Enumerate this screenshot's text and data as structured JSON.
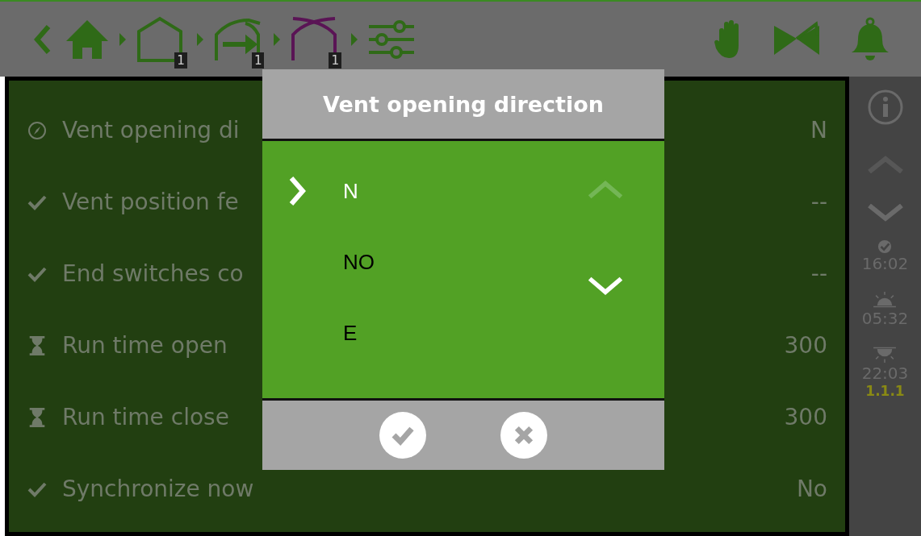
{
  "breadcrumb": [
    {
      "kind": "home"
    },
    {
      "kind": "house",
      "badge": "1",
      "color": "#2f6a17"
    },
    {
      "kind": "vent",
      "badge": "1",
      "color": "#2f6a17"
    },
    {
      "kind": "roof",
      "badge": "1",
      "color": "#5a1455"
    },
    {
      "kind": "settings"
    }
  ],
  "rows": [
    {
      "kind": "compass",
      "label": "Vent opening di",
      "value": "N"
    },
    {
      "kind": "check",
      "label": "Vent position fe",
      "value": "--"
    },
    {
      "kind": "check",
      "label": "End switches co",
      "value": "--"
    },
    {
      "kind": "timer",
      "label": "Run time open",
      "value": "300"
    },
    {
      "kind": "timer",
      "label": "Run time close",
      "value": "300"
    },
    {
      "kind": "check",
      "label": "Synchronize now",
      "value": "No"
    }
  ],
  "sidebar": {
    "up_disabled": true,
    "down_disabled": false,
    "times": [
      {
        "kind": "clock",
        "time": "16:02"
      },
      {
        "kind": "sunrise",
        "time": "05:32"
      },
      {
        "kind": "sunset",
        "time": "22:03"
      }
    ],
    "version": "1.1.1"
  },
  "dialog": {
    "title": "Vent opening direction",
    "options": [
      {
        "label": "N",
        "selected": true
      },
      {
        "label": "NO",
        "selected": false
      },
      {
        "label": "E",
        "selected": false
      }
    ],
    "up_disabled": true,
    "down_disabled": false
  }
}
